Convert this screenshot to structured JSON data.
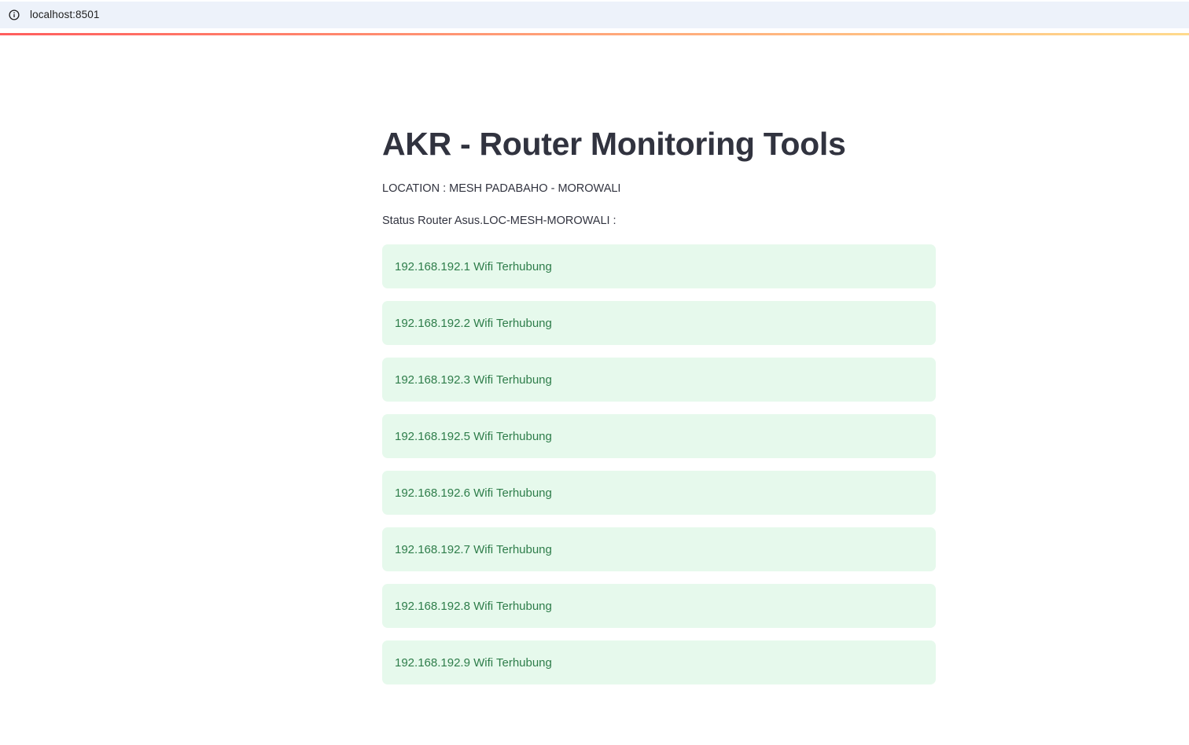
{
  "browser": {
    "url": "localhost:8501"
  },
  "header": {
    "title": "AKR - Router Monitoring Tools"
  },
  "info": {
    "location": "LOCATION : MESH PADABAHO - MOROWALI",
    "status_heading": "Status Router Asus.LOC-MESH-MOROWALI :"
  },
  "status_items": [
    {
      "text": "192.168.192.1 Wifi Terhubung"
    },
    {
      "text": "192.168.192.2 Wifi Terhubung"
    },
    {
      "text": "192.168.192.3 Wifi Terhubung"
    },
    {
      "text": "192.168.192.5 Wifi Terhubung"
    },
    {
      "text": "192.168.192.6 Wifi Terhubung"
    },
    {
      "text": "192.168.192.7 Wifi Terhubung"
    },
    {
      "text": "192.168.192.8 Wifi Terhubung"
    },
    {
      "text": "192.168.192.9 Wifi Terhubung"
    }
  ],
  "colors": {
    "success_background": "#e6f9ec",
    "success_text": "#2e7d4a",
    "accent_gradient_start": "#ff4b4b",
    "accent_gradient_end": "#ffd680"
  }
}
